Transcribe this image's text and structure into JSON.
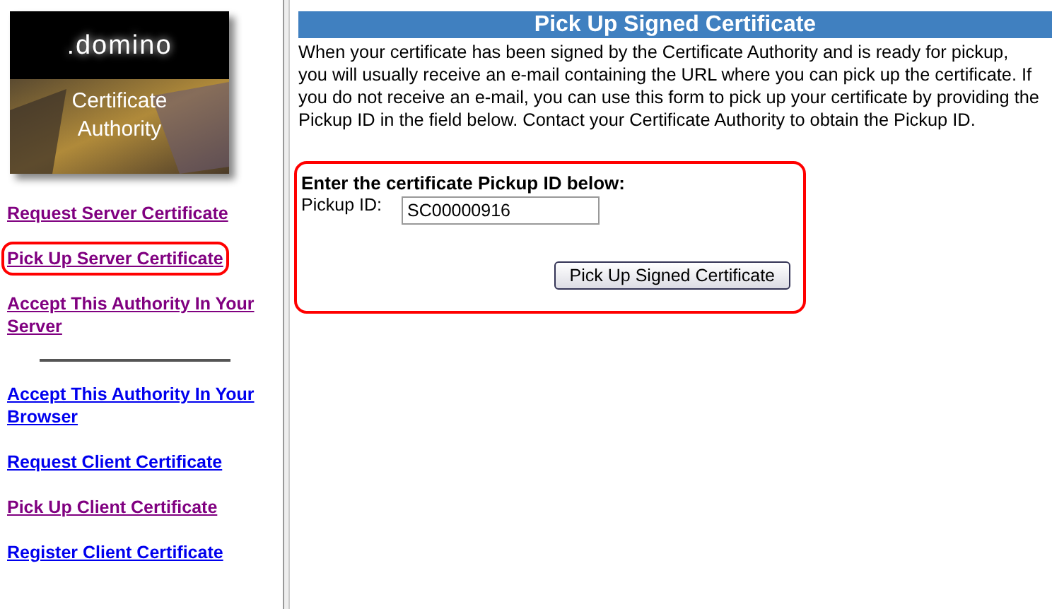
{
  "logo": {
    "brand": ".domino",
    "caption": "Certificate Authority"
  },
  "sidebar": {
    "items": [
      {
        "label": "Request Server Certificate",
        "visited": true,
        "highlighted": false,
        "divider_after": false
      },
      {
        "label": "Pick Up Server Certificate",
        "visited": true,
        "highlighted": true,
        "divider_after": false
      },
      {
        "label": "Accept This Authority In Your Server",
        "visited": true,
        "highlighted": false,
        "divider_after": true
      },
      {
        "label": "Accept This Authority In Your Browser",
        "visited": false,
        "highlighted": false,
        "divider_after": false
      },
      {
        "label": "Request Client Certificate",
        "visited": false,
        "highlighted": false,
        "divider_after": false
      },
      {
        "label": "Pick Up Client Certificate",
        "visited": true,
        "highlighted": false,
        "divider_after": false
      },
      {
        "label": "Register Client Certificate",
        "visited": false,
        "highlighted": false,
        "divider_after": false
      }
    ]
  },
  "main": {
    "title": "Pick Up Signed Certificate",
    "intro": "When your certificate has been signed by the Certificate Authority and is ready for pickup, you will usually receive an e-mail containing the URL where you can pick up the certificate. If you do not receive an e-mail, you can use this form to pick up your certificate by providing the Pickup ID in the field below. Contact your Certificate Authority to obtain the Pickup ID.",
    "form": {
      "highlighted": true,
      "heading": "Enter the certificate Pickup ID below:",
      "field_label": "Pickup ID:",
      "field_value": "SC00000916",
      "button": "Pick Up Signed Certificate"
    }
  }
}
